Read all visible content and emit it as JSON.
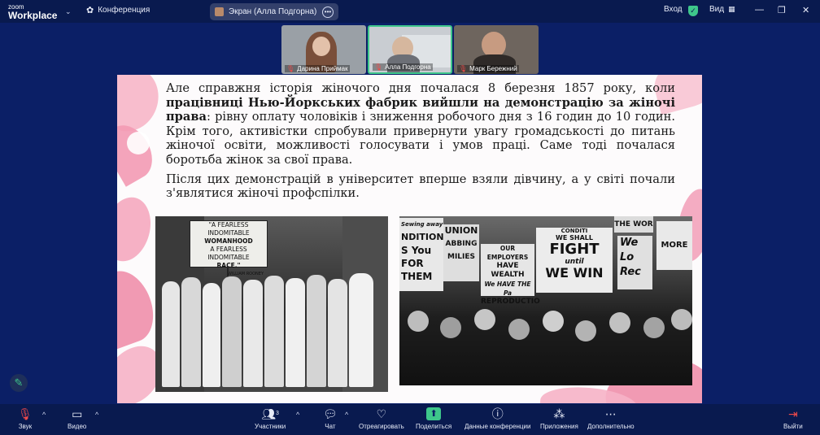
{
  "app": {
    "logo_line1": "zoom",
    "logo_line2": "Workplace",
    "meeting_label": "Конференция",
    "share_label": "Экран (Алла Подгорна)",
    "signin_label": "Вход",
    "view_label": "Вид"
  },
  "participants": [
    {
      "name": "Дарина Приймак"
    },
    {
      "name": "Алла Подгорна"
    },
    {
      "name": "Марк Бережний"
    }
  ],
  "slide": {
    "p1_plain_start": "Але справжня історія жіночого дня почалася 8 березня 1857 року, коли ",
    "p1_bold": "працівниці Нью-Йоркських фабрик вийшли на демонстрацію за жіночі права",
    "p1_plain_end": ": рівну оплату чоловіків і зниження робочого дня з 16 годин до 10 годин. Крім того, активістки спробували привернути увагу громадськості до питань жіночої освіти, можливості голосувати і умов праці. Саме тоді почалася боротьба жінок за свої права.",
    "p2": "Після цих демонстрацій в університет вперше взяли дівчину, а у світі почали з'являтися жіночі профспілки.",
    "photo1_sign": [
      "\"A FEARLESS INDOMITABLE",
      "WOMANHOOD",
      "A FEARLESS INDOMITABLE",
      "RACE.\"",
      "WILLIAM ROONEY"
    ],
    "photo2_signs": [
      "WE SHALL",
      "FIGHT",
      "until",
      "WE WIN",
      "UNION",
      "NDITIONS",
      "S You",
      "FOR THEM",
      "OUR EMPLOYERS",
      "HAVE WEALTH",
      "We HAVE THE Pa",
      "REPRODUCTIO",
      "MORE",
      "We",
      "Lo",
      "Rec",
      "ABBING",
      "MILIES",
      "Sewing away",
      "THE WOR",
      "CONDITI"
    ]
  },
  "bottom": {
    "audio": "Звук",
    "video": "Видео",
    "participants": "Участники",
    "participants_count": "3",
    "chat": "Чат",
    "react": "Отреагировать",
    "share": "Поделиться",
    "info": "Данные конференции",
    "apps": "Приложения",
    "more": "Дополнительно",
    "leave": "Выйти"
  },
  "colors": {
    "bg": "#0b1f66",
    "bar": "#091a4f",
    "accent_green": "#3ec78b",
    "muted_red": "#f24a4a"
  }
}
